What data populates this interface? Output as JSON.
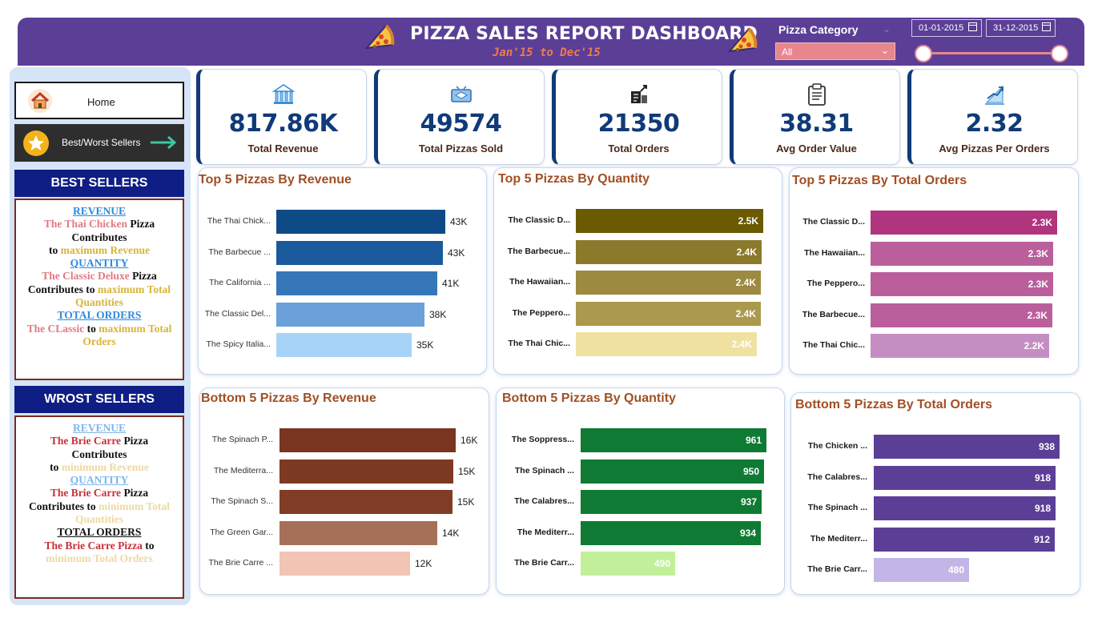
{
  "header": {
    "title": "PIZZA SALES REPORT DASHBOARD",
    "subtitle": "Jan'15 to Dec'15",
    "category_filter_label": "Pizza Category",
    "category_filter_value": "All",
    "date_start": "01-01-2015",
    "date_end": "31-12-2015"
  },
  "nav": {
    "home_label": "Home",
    "best_worst_label": "Best/Worst Sellers"
  },
  "best_sellers": {
    "heading": "BEST SELLERS",
    "revenue_label": "REVENUE",
    "revenue_pizza": "The Thai Chicken",
    "revenue_word_pizza": "Pizza",
    "contributes": "Contributes",
    "to": "to",
    "max_revenue": "maximum Revenue",
    "quantity_label": "QUANTITY",
    "quantity_pizza": "The Classic Deluxe",
    "contributes_to": "Contributes to",
    "max_total": "maximum Total",
    "quantities": "Quantities",
    "orders_label": "TOTAL ORDERS",
    "orders_pizza": "The CLassic",
    "max_total_orders_a": "maximum Total",
    "orders_word": "Orders"
  },
  "worst_sellers": {
    "heading": "WROST SELLERS",
    "revenue_label": "REVENUE",
    "revenue_pizza": "The Brie Carre",
    "revenue_word_pizza": "Pizza",
    "contributes": "Contributes",
    "to": "to",
    "min_revenue": "minimum Revenue",
    "quantity_label": "QUANTITY",
    "quantity_pizza": "The Brie Carre",
    "contributes_to": "Contributes to",
    "min_total": "minimum Total",
    "quantities": "Quantities",
    "orders_label": "TOTAL ORDERS",
    "orders_pizza": "The Brie Carre Pizza",
    "min_total_orders": "minimum Total Orders"
  },
  "kpis": [
    {
      "value": "817.86K",
      "label": "Total Revenue",
      "icon": "bank-icon"
    },
    {
      "value": "49574",
      "label": "Total Pizzas Sold",
      "icon": "pizza-box-icon"
    },
    {
      "value": "21350",
      "label": "Total Orders",
      "icon": "orders-icon"
    },
    {
      "value": "38.31",
      "label": "Avg Order Value",
      "icon": "clipboard-icon"
    },
    {
      "value": "2.32",
      "label": "Avg Pizzas Per Orders",
      "icon": "growth-chart-icon"
    }
  ],
  "chart_data": [
    {
      "type": "bar",
      "title": "Top 5 Pizzas By Revenue",
      "categories": [
        "The Thai Chick...",
        "The Barbecue ...",
        "The California ...",
        "The Classic Del...",
        "The Spicy Italia..."
      ],
      "values": [
        43434,
        42768,
        41410,
        38180,
        34831
      ],
      "value_labels": [
        "43K",
        "43K",
        "41K",
        "38K",
        "35K"
      ],
      "colors": [
        "#0e4a86",
        "#1a5a9c",
        "#3577b8",
        "#6aa1d8",
        "#a6d3f8"
      ]
    },
    {
      "type": "bar",
      "title": "Top 5 Pizzas By Quantity",
      "categories": [
        "The Classic D...",
        "The Barbecue...",
        "The Hawaiian...",
        "The Peppero...",
        "The Thai Chic..."
      ],
      "values": [
        2453,
        2432,
        2422,
        2418,
        2371
      ],
      "value_labels": [
        "2.5K",
        "2.4K",
        "2.4K",
        "2.4K",
        "2.4K"
      ],
      "colors": [
        "#6b5a00",
        "#8c7a2c",
        "#9c8a40",
        "#ab9a4e",
        "#efe2a0"
      ]
    },
    {
      "type": "bar",
      "title": "Top 5 Pizzas By Total Orders",
      "categories": [
        "The Classic D...",
        "The Hawaiian...",
        "The Peppero...",
        "The Barbecue...",
        "The Thai Chic..."
      ],
      "values": [
        2329,
        2280,
        2278,
        2273,
        2225
      ],
      "value_labels": [
        "2.3K",
        "2.3K",
        "2.3K",
        "2.3K",
        "2.2K"
      ],
      "colors": [
        "#b0357e",
        "#bb5f9c",
        "#bb5f9c",
        "#bb5f9c",
        "#c58ec2"
      ]
    },
    {
      "type": "bar",
      "title": "Bottom 5 Pizzas By Revenue",
      "categories": [
        "The Spinach P...",
        "The Mediterra...",
        "The Spinach S...",
        "The Green Gar...",
        "The Brie Carre ..."
      ],
      "values": [
        15596,
        15360,
        15278,
        13956,
        11589
      ],
      "value_labels": [
        "16K",
        "15K",
        "15K",
        "14K",
        "12K"
      ],
      "colors": [
        "#7a3520",
        "#7d3a22",
        "#803c25",
        "#a67058",
        "#f2c4b4"
      ]
    },
    {
      "type": "bar",
      "title": "Bottom 5 Pizzas By Quantity",
      "categories": [
        "The Soppress...",
        "The Spinach ...",
        "The Calabres...",
        "The Mediterr...",
        "The Brie Carr..."
      ],
      "values": [
        961,
        950,
        937,
        934,
        490
      ],
      "value_labels": [
        "961",
        "950",
        "937",
        "934",
        "490"
      ],
      "colors": [
        "#0f7a33",
        "#0f7a33",
        "#0f7a33",
        "#0f7a33",
        "#c2f09a"
      ]
    },
    {
      "type": "bar",
      "title": "Bottom 5 Pizzas By Total Orders",
      "categories": [
        "The Chicken ...",
        "The Calabres...",
        "The Spinach ...",
        "The Mediterr...",
        "The Brie Carr..."
      ],
      "values": [
        938,
        918,
        918,
        912,
        480
      ],
      "value_labels": [
        "938",
        "918",
        "918",
        "912",
        "480"
      ],
      "colors": [
        "#5b3f97",
        "#5b3f97",
        "#5b3f97",
        "#5b3f97",
        "#c3b6e6"
      ]
    }
  ]
}
